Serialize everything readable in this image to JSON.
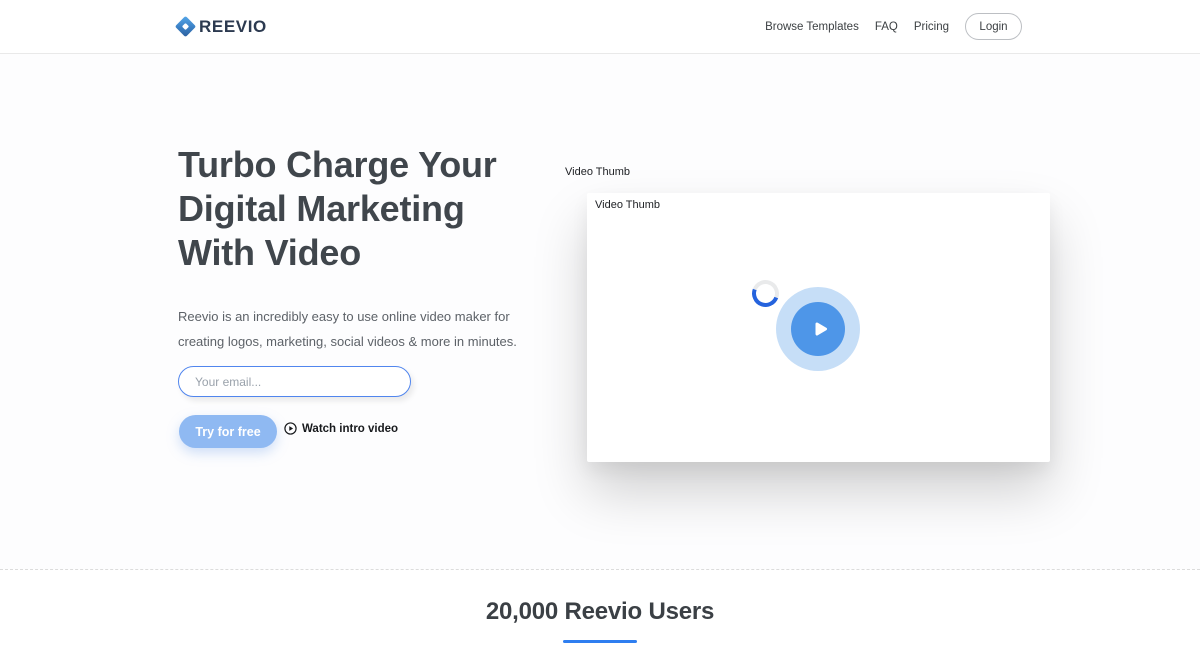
{
  "header": {
    "logo_text": "REEVIO",
    "nav_items": [
      {
        "label": "Browse Templates"
      },
      {
        "label": "FAQ"
      },
      {
        "label": "Pricing"
      }
    ],
    "login_label": "Login"
  },
  "hero": {
    "heading_line1": "Turbo Charge Your",
    "heading_line2": "Digital Marketing",
    "heading_line3": "With Video",
    "description_line1": "Reevio is an incredibly easy to use online video maker for",
    "description_line2": "creating logos, marketing, social videos & more in minutes.",
    "email_placeholder": "Your email...",
    "email_value": "",
    "cta_label": "Try for free",
    "watch_label": "Watch intro video",
    "video": {
      "outer_alt": "Video Thumb",
      "inner_alt": "Video Thumb"
    }
  },
  "users": {
    "heading": "20,000 Reevio Users"
  },
  "icons": {
    "logo_diamond_icon": "blue diamond with white center",
    "circle_play_icon": "play triangle inside outline circle",
    "play_icon": "white play triangle",
    "spinner_icon": "loading ring, blue arc on gray"
  },
  "colors": {
    "accent_blue": "#2f7ef0",
    "cta_button_blue": "#8fb9f2",
    "input_border_blue": "#5186ee",
    "play_inner_blue": "#4e96e8",
    "play_outer_blue": "#c6def7",
    "spinner_blue": "#2563dd",
    "logo_navy": "#2c3a50",
    "heading_gray": "#40464c",
    "body_gray": "#5d6268"
  }
}
